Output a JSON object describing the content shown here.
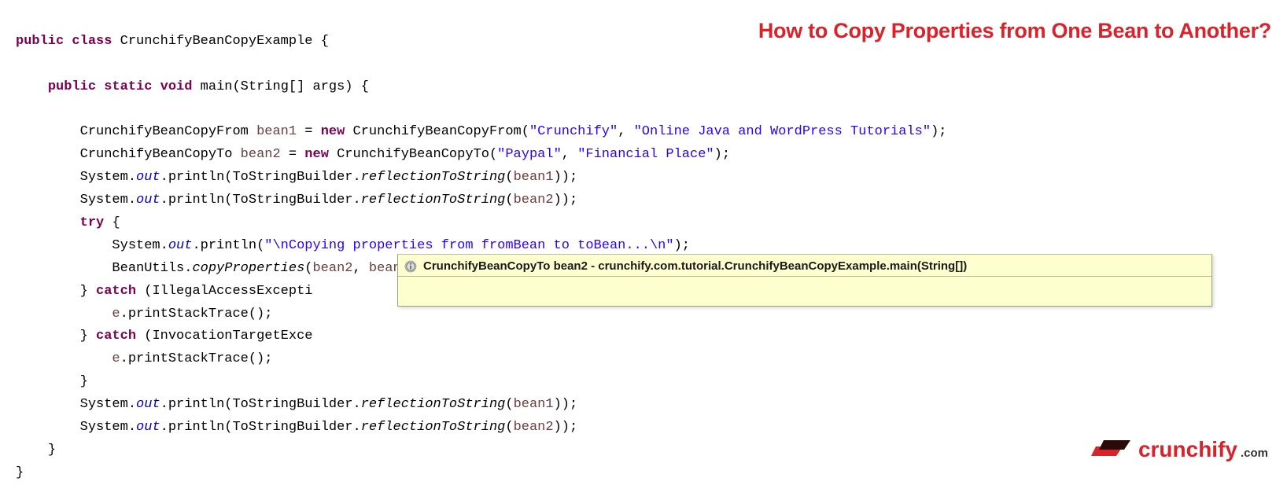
{
  "overlay": {
    "title": "How to Copy Properties from One Bean to Another?"
  },
  "code": {
    "kw_public": "public",
    "kw_class": "class",
    "kw_static": "static",
    "kw_void": "void",
    "kw_new": "new",
    "kw_try": "try",
    "kw_catch": "catch",
    "class_name": "CrunchifyBeanCopyExample",
    "main_sig": "main(String[] args)",
    "type_from": "CrunchifyBeanCopyFrom",
    "type_to": "CrunchifyBeanCopyTo",
    "var_bean1": "bean1",
    "var_bean2": "bean2",
    "str_crunchify": "\"Crunchify\"",
    "str_desc1": "\"Online Java and WordPress Tutorials\"",
    "str_paypal": "\"Paypal\"",
    "str_desc2": "\"Financial Place\"",
    "system": "System",
    "out": "out",
    "println": "println",
    "tsb": "ToStringBuilder",
    "refl": "reflectionToString",
    "str_copy": "\"\\nCopying properties from fromBean to toBean...\\n\"",
    "beanutils": "BeanUtils",
    "copyprops": "copyProperties",
    "exc1": "IllegalAccessExcepti",
    "exc2": "InvocationTargetExce",
    "printstack": "printStackTrace",
    "var_e": "e"
  },
  "tooltip": {
    "text": "CrunchifyBeanCopyTo bean2 - crunchify.com.tutorial.CrunchifyBeanCopyExample.main(String[])"
  },
  "logo": {
    "brand": "crunchify",
    "tld": ".com"
  }
}
